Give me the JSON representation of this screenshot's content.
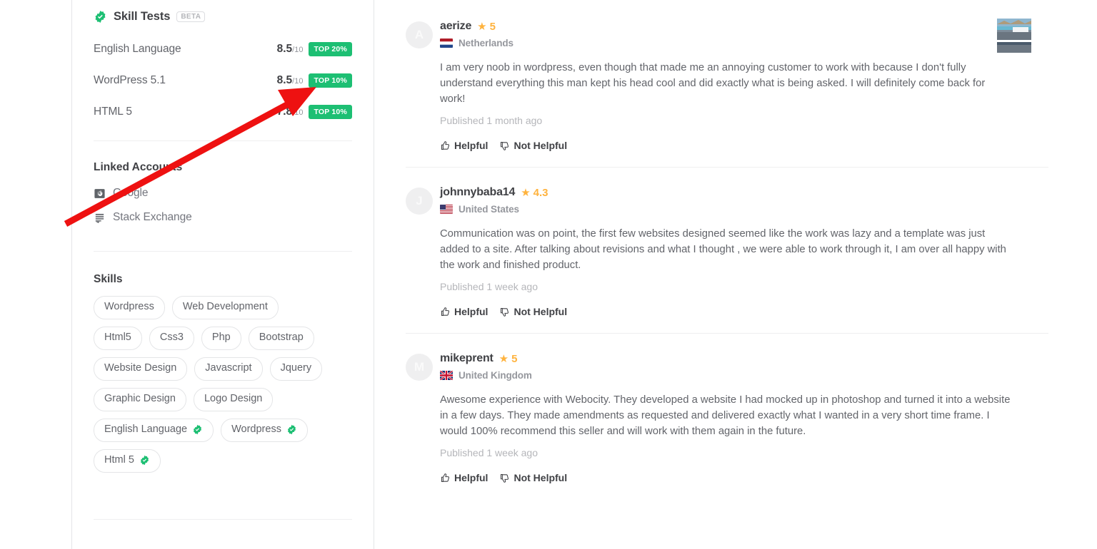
{
  "sidebar": {
    "skill_tests": {
      "title": "Skill Tests",
      "beta_label": "BETA",
      "verified_icon": "verified-check-icon",
      "tests": [
        {
          "name": "English Language",
          "score": "8.5",
          "denominator": "/10",
          "badge": "TOP 20%"
        },
        {
          "name": "WordPress 5.1",
          "score": "8.5",
          "denominator": "/10",
          "badge": "TOP 10%"
        },
        {
          "name": "HTML 5",
          "score": "7.8",
          "denominator": "/10",
          "badge": "TOP 10%"
        }
      ]
    },
    "linked_accounts": {
      "title": "Linked Accounts",
      "items": [
        {
          "label": "Google",
          "icon": "google-icon"
        },
        {
          "label": "Stack Exchange",
          "icon": "stack-exchange-icon"
        }
      ]
    },
    "skills": {
      "title": "Skills",
      "tags": [
        {
          "label": "Wordpress",
          "verified": false
        },
        {
          "label": "Web Development",
          "verified": false
        },
        {
          "label": "Html5",
          "verified": false
        },
        {
          "label": "Css3",
          "verified": false
        },
        {
          "label": "Php",
          "verified": false
        },
        {
          "label": "Bootstrap",
          "verified": false
        },
        {
          "label": "Website Design",
          "verified": false
        },
        {
          "label": "Javascript",
          "verified": false
        },
        {
          "label": "Jquery",
          "verified": false
        },
        {
          "label": "Graphic Design",
          "verified": false
        },
        {
          "label": "Logo Design",
          "verified": false
        },
        {
          "label": "English Language",
          "verified": true
        },
        {
          "label": "Wordpress",
          "verified": true
        },
        {
          "label": "Html 5",
          "verified": true
        }
      ]
    }
  },
  "reviews": {
    "helpful_label": "Helpful",
    "not_helpful_label": "Not Helpful",
    "items": [
      {
        "avatar_initial": "A",
        "reviewer": "aerize",
        "rating": "5",
        "country": "Netherlands",
        "flag": "netherlands-flag",
        "text": "I am very noob in wordpress, even though that made me an annoying customer to work with because I don't fully understand everything this man kept his head cool and did exactly what is being asked. I will definitely come back for work!",
        "published": "Published 1 month ago",
        "has_thumbnail": true
      },
      {
        "avatar_initial": "J",
        "reviewer": "johnnybaba14",
        "rating": "4.3",
        "country": "United States",
        "flag": "united-states-flag",
        "text": "Communication was on point, the first few websites designed seemed like the work was lazy and a template was just added to a site. After talking about revisions and what I thought , we were able to work through it, I am over all happy with the work and finished product.",
        "published": "Published 1 week ago",
        "has_thumbnail": false
      },
      {
        "avatar_initial": "M",
        "reviewer": "mikeprent",
        "rating": "5",
        "country": "United Kingdom",
        "flag": "united-kingdom-flag",
        "text": "Awesome experience with Webocity. They developed a website I had mocked up in photoshop and turned it into a website in a few days. They made amendments as requested and delivered exactly what I wanted in a very short time frame. I would 100% recommend this seller and will work with them again in the future.",
        "published": "Published 1 week ago",
        "has_thumbnail": false
      }
    ]
  },
  "annotation": {
    "type": "red-arrow",
    "color": "#ee1111",
    "points_at": "WordPress 5.1 TOP 10% badge"
  },
  "colors": {
    "badge_green": "#1dbf73",
    "star_orange": "#ffb33e",
    "text_dark": "#404145",
    "text_gray": "#62646a",
    "muted": "#95979d"
  }
}
